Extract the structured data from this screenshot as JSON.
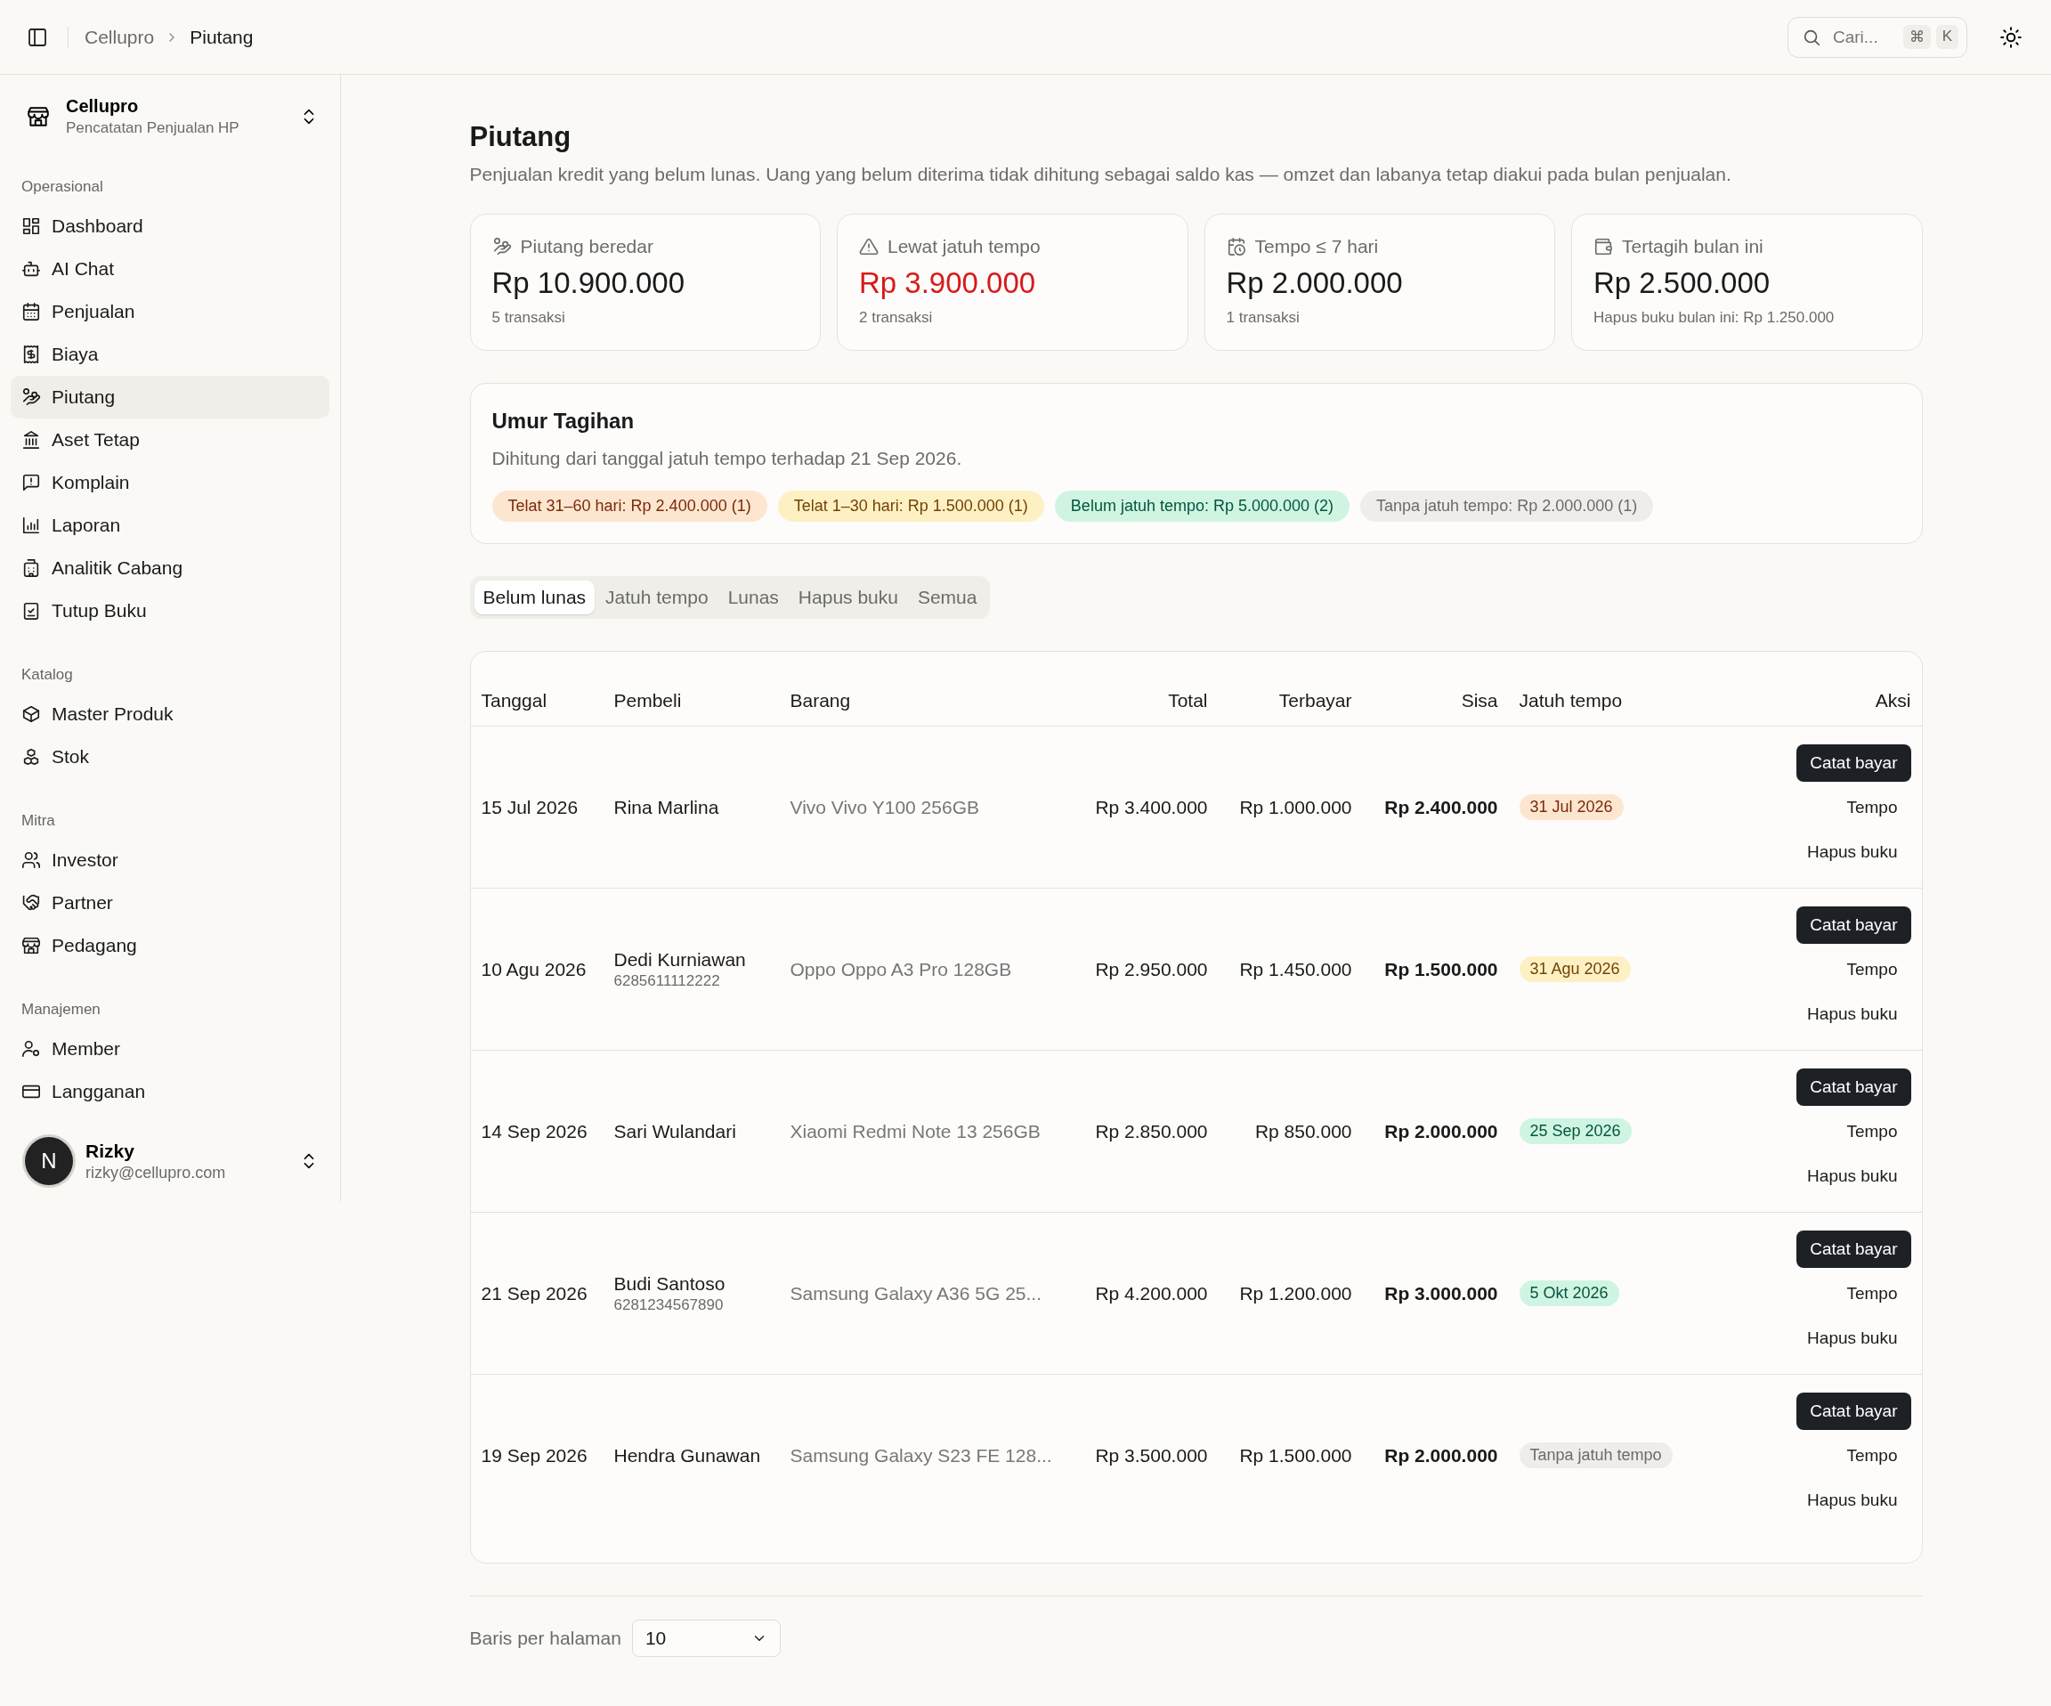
{
  "header": {
    "breadcrumbs": [
      {
        "label": "Cellupro",
        "selected": false
      },
      {
        "label": "Piutang",
        "selected": true
      }
    ],
    "search": {
      "placeholder": "Cari...",
      "keys": [
        "⌘",
        "K"
      ]
    }
  },
  "sidebar": {
    "org": {
      "name": "Cellupro",
      "subtitle": "Pencatatan Penjualan HP"
    },
    "groups": [
      {
        "title": "Operasional",
        "items": [
          {
            "label": "Dashboard",
            "selected": false
          },
          {
            "label": "AI Chat",
            "selected": false
          },
          {
            "label": "Penjualan",
            "selected": false
          },
          {
            "label": "Biaya",
            "selected": false
          },
          {
            "label": "Piutang",
            "selected": true
          },
          {
            "label": "Aset Tetap",
            "selected": false
          },
          {
            "label": "Komplain",
            "selected": false
          },
          {
            "label": "Laporan",
            "selected": false
          },
          {
            "label": "Analitik Cabang",
            "selected": false
          },
          {
            "label": "Tutup Buku",
            "selected": false
          }
        ]
      },
      {
        "title": "Katalog",
        "items": [
          {
            "label": "Master Produk",
            "selected": false
          },
          {
            "label": "Stok",
            "selected": false
          }
        ]
      },
      {
        "title": "Mitra",
        "items": [
          {
            "label": "Investor",
            "selected": false
          },
          {
            "label": "Partner",
            "selected": false
          },
          {
            "label": "Pedagang",
            "selected": false
          }
        ]
      },
      {
        "title": "Manajemen",
        "items": [
          {
            "label": "Member",
            "selected": false
          },
          {
            "label": "Langganan",
            "selected": false
          }
        ]
      }
    ],
    "user": {
      "avatar": "N",
      "name": "Rizky",
      "email": "rizky@cellupro.com"
    }
  },
  "page": {
    "title": "Piutang",
    "description": "Penjualan kredit yang belum lunas. Uang yang belum diterima tidak dihitung sebagai saldo kas — omzet dan labanya tetap diakui pada bulan penjualan."
  },
  "summary_cards": [
    {
      "label": "Piutang beredar",
      "value": "Rp 10.900.000",
      "note": "5 transaksi",
      "alert": false
    },
    {
      "label": "Lewat jatuh tempo",
      "value": "Rp 3.900.000",
      "note": "2 transaksi",
      "alert": true
    },
    {
      "label": "Tempo ≤ 7 hari",
      "value": "Rp 2.000.000",
      "note": "1 transaksi",
      "alert": false
    },
    {
      "label": "Tertagih bulan ini",
      "value": "Rp 2.500.000",
      "note": "Hapus buku bulan ini: Rp 1.250.000",
      "alert": false
    }
  ],
  "aging": {
    "title": "Umur Tagihan",
    "subtitle": "Dihitung dari tanggal jatuh tempo terhadap 21 Sep 2026.",
    "buckets": [
      {
        "label": "Telat 31–60 hari: Rp 2.400.000 (1)",
        "kind": "late"
      },
      {
        "label": "Telat 1–30 hari: Rp 1.500.000 (1)",
        "kind": "warn"
      },
      {
        "label": "Belum jatuh tempo: Rp 5.000.000 (2)",
        "kind": "ok"
      },
      {
        "label": "Tanpa jatuh tempo: Rp 2.000.000 (1)",
        "kind": "none"
      }
    ]
  },
  "tabs": [
    {
      "label": "Belum lunas",
      "selected": true
    },
    {
      "label": "Jatuh tempo",
      "selected": false
    },
    {
      "label": "Lunas",
      "selected": false
    },
    {
      "label": "Hapus buku",
      "selected": false
    },
    {
      "label": "Semua",
      "selected": false
    }
  ],
  "table": {
    "columns": [
      "Tanggal",
      "Pembeli",
      "Barang",
      "Total",
      "Terbayar",
      "Sisa",
      "Jatuh tempo",
      "Aksi"
    ],
    "rows": [
      {
        "date": "15 Jul 2026",
        "buyer": "Rina Marlina",
        "item": "Vivo Vivo Y100 256GB",
        "total": "Rp 3.400.000",
        "paid": "Rp 1.000.000",
        "remaining": "Rp 2.400.000",
        "due": {
          "label": "31 Jul 2026",
          "kind": "late"
        },
        "actions": [
          "Catat bayar",
          "Tempo",
          "Hapus buku"
        ]
      },
      {
        "date": "10 Agu 2026",
        "buyer": "Dedi Kurniawan",
        "phone": "6285611112222",
        "item": "Oppo Oppo A3 Pro 128GB",
        "total": "Rp 2.950.000",
        "paid": "Rp 1.450.000",
        "remaining": "Rp 1.500.000",
        "due": {
          "label": "31 Agu 2026",
          "kind": "warn"
        },
        "actions": [
          "Catat bayar",
          "Tempo",
          "Hapus buku"
        ]
      },
      {
        "date": "14 Sep 2026",
        "buyer": "Sari Wulandari",
        "item": "Xiaomi Redmi Note 13 256GB",
        "total": "Rp 2.850.000",
        "paid": "Rp 850.000",
        "remaining": "Rp 2.000.000",
        "due": {
          "label": "25 Sep 2026",
          "kind": "ok"
        },
        "actions": [
          "Catat bayar",
          "Tempo",
          "Hapus buku"
        ]
      },
      {
        "date": "21 Sep 2026",
        "buyer": "Budi Santoso",
        "phone": "6281234567890",
        "item": "Samsung Galaxy A36 5G 25...",
        "total": "Rp 4.200.000",
        "paid": "Rp 1.200.000",
        "remaining": "Rp 3.000.000",
        "due": {
          "label": "5 Okt 2026",
          "kind": "ok"
        },
        "actions": [
          "Catat bayar",
          "Tempo",
          "Hapus buku"
        ]
      },
      {
        "date": "19 Sep 2026",
        "buyer": "Hendra Gunawan",
        "item": "Samsung Galaxy S23 FE 128...",
        "total": "Rp 3.500.000",
        "paid": "Rp 1.500.000",
        "remaining": "Rp 2.000.000",
        "due": {
          "label": "Tanpa jatuh tempo",
          "kind": "none"
        },
        "actions": [
          "Catat bayar",
          "Tempo",
          "Hapus buku"
        ]
      }
    ]
  },
  "pagination": {
    "label": "Baris per halaman",
    "value": "10"
  }
}
